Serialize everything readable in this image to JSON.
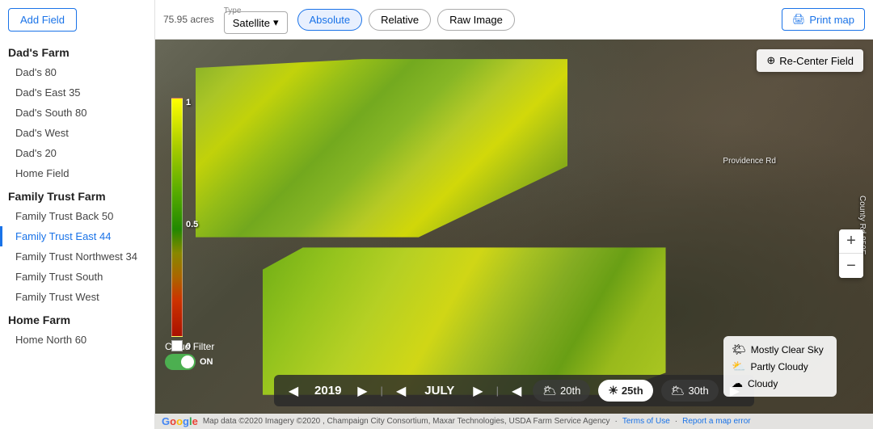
{
  "sidebar": {
    "add_field_label": "Add Field",
    "farms": [
      {
        "name": "Dad's Farm",
        "fields": [
          {
            "label": "Dad's 80",
            "active": false
          },
          {
            "label": "Dad's East 35",
            "active": false
          },
          {
            "label": "Dad's South 80",
            "active": false
          },
          {
            "label": "Dad's West",
            "active": false
          },
          {
            "label": "Dad's 20",
            "active": false
          },
          {
            "label": "Home Field",
            "active": false
          }
        ]
      },
      {
        "name": "Family Trust Farm",
        "fields": [
          {
            "label": "Family Trust Back 50",
            "active": false
          },
          {
            "label": "Family Trust East 44",
            "active": true
          },
          {
            "label": "Family Trust Northwest 34",
            "active": false
          },
          {
            "label": "Family Trust South",
            "active": false
          },
          {
            "label": "Family Trust West",
            "active": false
          }
        ]
      },
      {
        "name": "Home Farm",
        "fields": [
          {
            "label": "Home North 60",
            "active": false
          }
        ]
      }
    ]
  },
  "topbar": {
    "acres": "75.95 acres",
    "type_label": "Type",
    "satellite_label": "Satellite",
    "view_buttons": [
      "Absolute",
      "Relative",
      "Raw Image"
    ],
    "active_view": "Absolute",
    "print_label": "Print map"
  },
  "map": {
    "recenter_label": "Re-Center Field",
    "zoom_in": "+",
    "zoom_out": "−",
    "legend_top": "1",
    "legend_mid": "0.5",
    "legend_bot": "0",
    "road_labels": [
      "County Rd 850E",
      "Providence Rd"
    ]
  },
  "timeline": {
    "prev_year": "◀",
    "year": "2019",
    "next_year": "▶",
    "prev_month": "◀",
    "month": "JULY",
    "next_month": "▶",
    "prev_dates": "◀",
    "dates": [
      "20th",
      "25th",
      "30th"
    ],
    "active_date": "25th",
    "next_dates": "▶",
    "date_icons": [
      "🌥",
      "☀",
      "🌥"
    ]
  },
  "cloud_filter": {
    "label": "Cloud Filter",
    "on_label": "ON"
  },
  "weather": {
    "items": [
      {
        "icon": "🌤",
        "label": "Mostly Clear Sky"
      },
      {
        "icon": "⛅",
        "label": "Partly Cloudy"
      },
      {
        "icon": "☁",
        "label": "Cloudy"
      }
    ]
  },
  "footer": {
    "google": "Google",
    "attribution": "Map data ©2020 Imagery ©2020 , Champaign City Consortium, Maxar Technologies, USDA Farm Service Agency",
    "terms": "Terms of Use",
    "report": "Report a map error"
  }
}
